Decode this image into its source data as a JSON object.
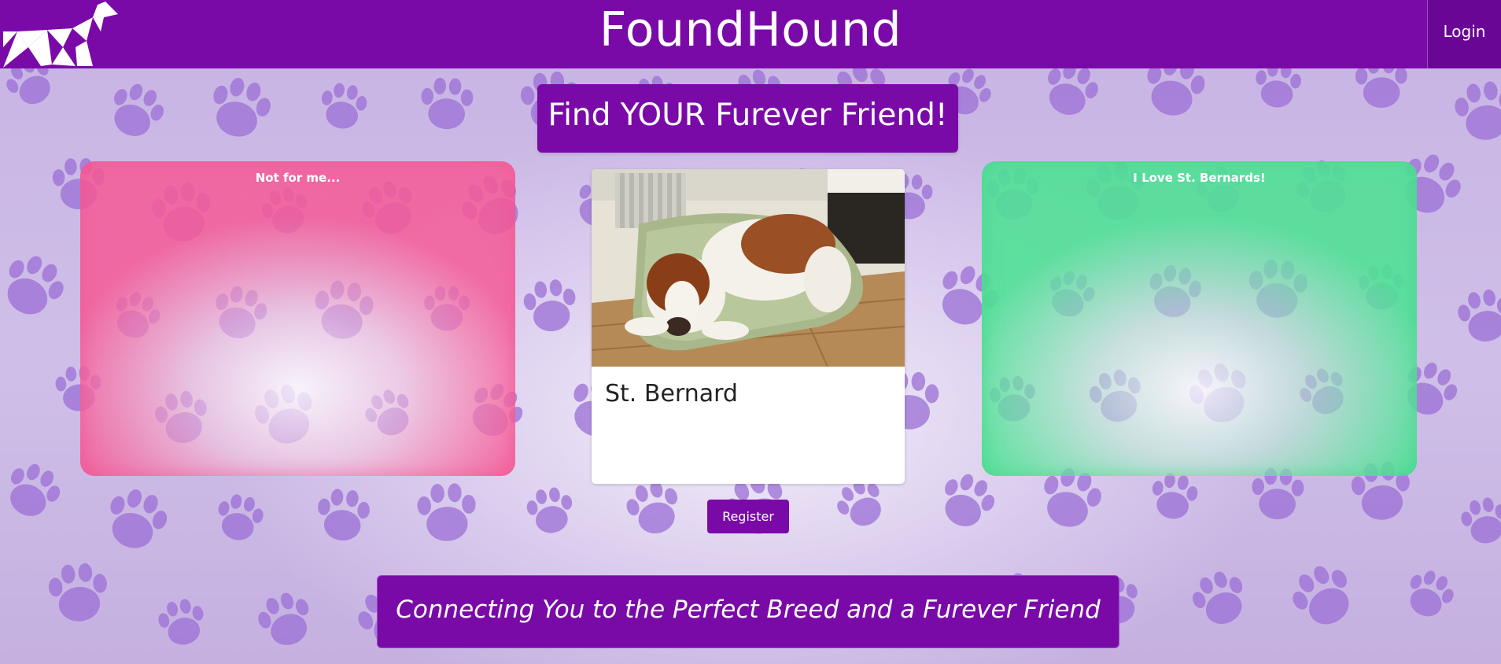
{
  "header": {
    "brand": "FoundHound",
    "login_label": "Login",
    "logo_icon": "origami-dog-logo-icon"
  },
  "headline": "Find YOUR Furever Friend!",
  "swipe": {
    "left_label": "Not for me...",
    "right_label": "I Love St. Bernards!"
  },
  "card": {
    "breed": "St. Bernard",
    "photo_icon": "st-bernard-dog-photo"
  },
  "register_label": "Register",
  "tagline": "Connecting You to the Perfect Breed and a Furever Friend",
  "colors": {
    "brand_purple": "#7a0aa8",
    "reject_pink": "#f55a96",
    "accept_green": "#50e196",
    "paw_purple": "#9b6fd6"
  }
}
